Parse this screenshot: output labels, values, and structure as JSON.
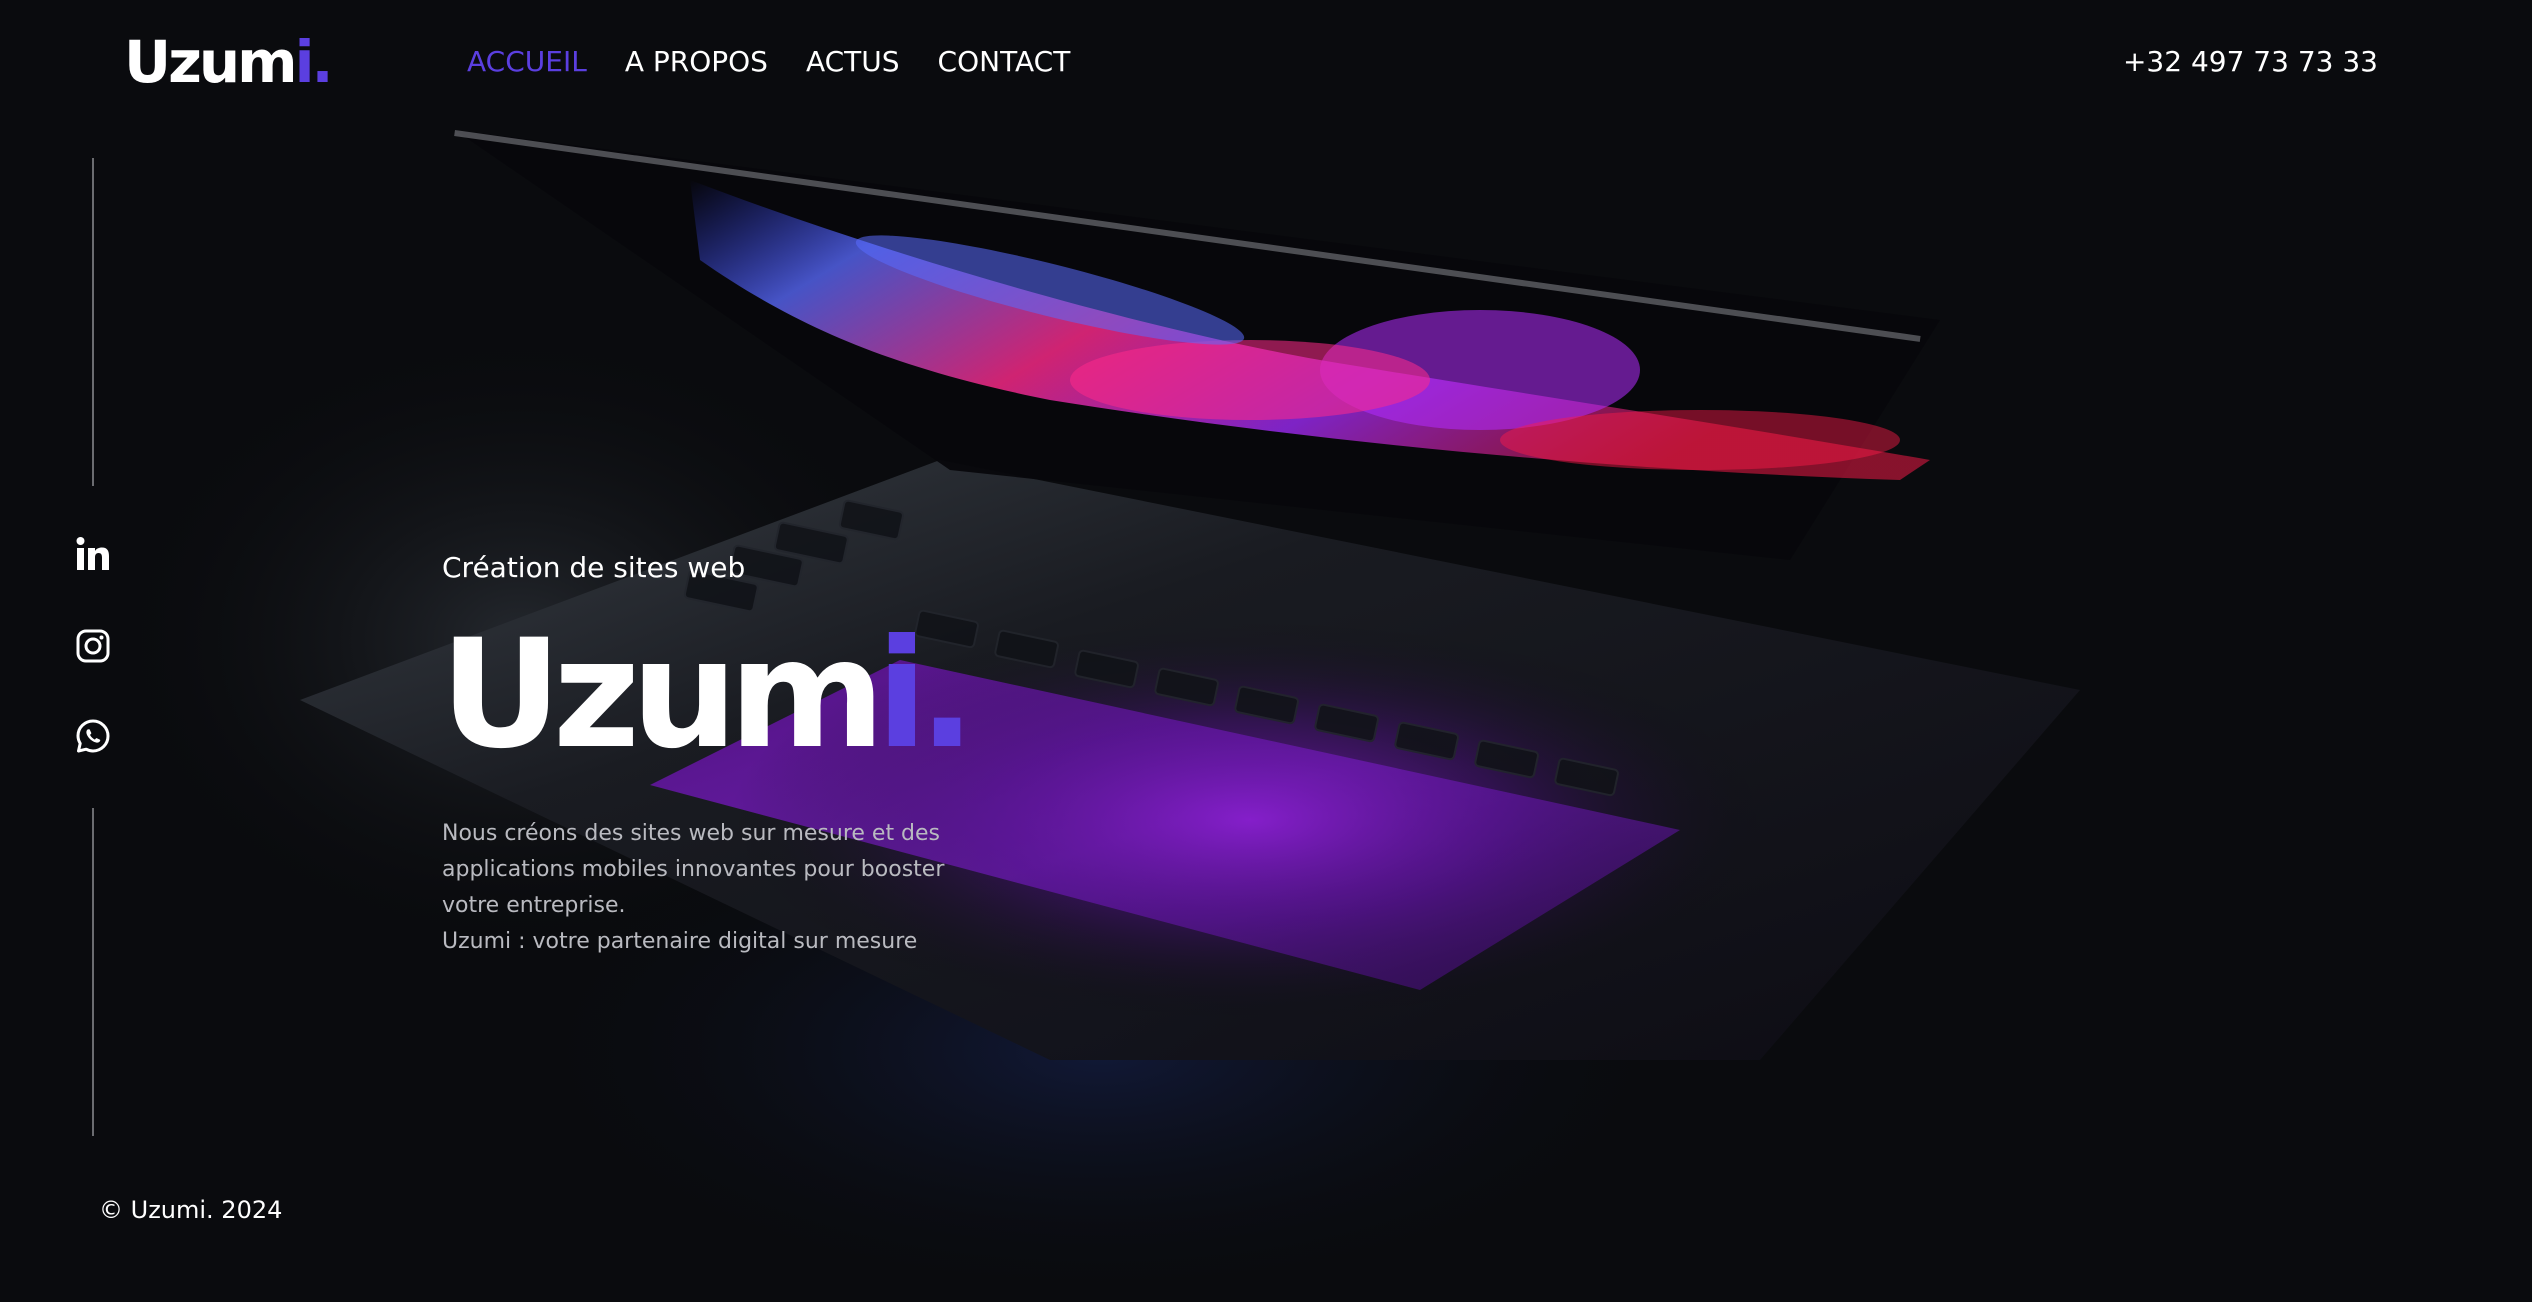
{
  "brand": {
    "logo_main": "Uzum",
    "logo_accent": "i.",
    "accent_color": "#5b3fe0"
  },
  "nav": {
    "items": [
      {
        "label": "ACCUEIL",
        "active": true
      },
      {
        "label": "A PROPOS",
        "active": false
      },
      {
        "label": "ACTUS",
        "active": false
      },
      {
        "label": "CONTACT",
        "active": false
      }
    ]
  },
  "header": {
    "phone": "+32 497 73 73 33"
  },
  "social": {
    "icons": [
      "linkedin-icon",
      "instagram-icon",
      "whatsapp-icon"
    ]
  },
  "hero": {
    "kicker": "Création de sites web",
    "title_main": "Uzum",
    "title_accent": "i.",
    "description_lines": [
      "Nous créons des sites web sur mesure et des",
      "applications mobiles innovantes pour booster",
      "votre entreprise.",
      "Uzumi : votre partenaire digital sur mesure"
    ]
  },
  "footer": {
    "copyright": "© Uzumi. 2024"
  },
  "colors": {
    "background": "#0a0b0e",
    "text": "#ffffff",
    "muted_text": "#b9bac0"
  }
}
